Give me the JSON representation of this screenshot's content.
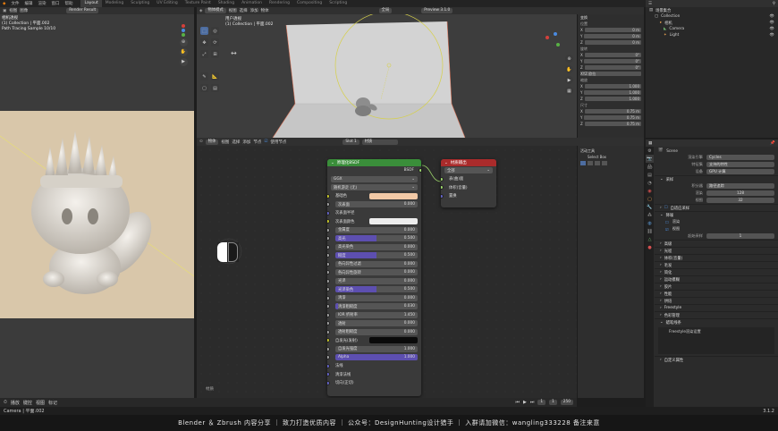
{
  "topbar": {
    "menus": [
      "文件",
      "编辑",
      "渲染",
      "窗口",
      "帮助"
    ],
    "tabs": [
      "Layout",
      "Modeling",
      "Sculpting",
      "UV Editing",
      "Texture Paint",
      "Shading",
      "Animation",
      "Rendering",
      "Compositing",
      "Scripting"
    ],
    "active_tab": "Layout",
    "scene": "Scene",
    "view_layer": "View Layer"
  },
  "image_editor": {
    "header_items": [
      "视图",
      "图像"
    ],
    "render_result": "Render Result",
    "info_lines": [
      "相机透视",
      "(1) Collection | 平面.002",
      "Path Tracing Sample 10/10"
    ]
  },
  "viewport": {
    "header_items": [
      "物体模式",
      "视图",
      "选择",
      "添加",
      "物体"
    ],
    "transform": "全局",
    "info_lines": [
      "用户透视",
      "(1) Collection | 平面.002"
    ],
    "view_mode": "Preview 3.1.0"
  },
  "n_panel": {
    "title": "变换",
    "loc_label": "位置",
    "loc": [
      [
        "X",
        "0 m"
      ],
      [
        "Y",
        "0 m"
      ],
      [
        "Z",
        "0 m"
      ]
    ],
    "rot_label": "旋转",
    "rot": [
      [
        "X",
        "0°"
      ],
      [
        "Y",
        "0°"
      ],
      [
        "Z",
        "0°"
      ]
    ],
    "mode": "XYZ 欧拉",
    "scale_label": "缩放",
    "scale": [
      [
        "X",
        "1.000"
      ],
      [
        "Y",
        "1.000"
      ],
      [
        "Z",
        "1.000"
      ]
    ],
    "dim_label": "尺寸",
    "dims": [
      [
        "X",
        "0.75 m"
      ],
      [
        "Y",
        "0.75 m"
      ],
      [
        "Z",
        "0.75 m"
      ]
    ]
  },
  "node_editor": {
    "header_items": [
      "物体",
      "视图",
      "选择",
      "添加",
      "节点"
    ],
    "use_nodes": "使用节点",
    "slot": "Slot 1",
    "material": "材质",
    "label": "材质"
  },
  "bsdf": {
    "title": "原理化BSDF",
    "out_label": "BSDF",
    "distribution": "GGX",
    "subsurface_method": "随机游走 (无)",
    "base_color_label": "基础色",
    "base_color": "#f2c9a6",
    "rows": [
      {
        "label": "次表面",
        "value": "0.000",
        "fill": 0
      },
      {
        "label": "次表面半径",
        "value": "",
        "fill": 0,
        "type": "vector"
      },
      {
        "label": "次表面颜色",
        "value": "",
        "fill": 0,
        "type": "color",
        "color": "#ececec"
      },
      {
        "label": "金属度",
        "value": "0.000",
        "fill": 0
      },
      {
        "label": "高光",
        "value": "0.500",
        "fill": 0.5
      },
      {
        "label": "高光染色",
        "value": "0.000",
        "fill": 0
      },
      {
        "label": "糙度",
        "value": "0.500",
        "fill": 0.5
      },
      {
        "label": "各向异性过滤",
        "value": "0.000",
        "fill": 0
      },
      {
        "label": "各向异性旋转",
        "value": "0.000",
        "fill": 0
      },
      {
        "label": "光泽",
        "value": "0.000",
        "fill": 0
      },
      {
        "label": "光泽染色",
        "value": "0.500",
        "fill": 0.5
      },
      {
        "label": "清漆",
        "value": "0.000",
        "fill": 0
      },
      {
        "label": "清漆粗糙度",
        "value": "0.030",
        "fill": 0.03
      },
      {
        "label": "IOR 折射率",
        "value": "1.450",
        "fill": 0
      },
      {
        "label": "透射",
        "value": "0.000",
        "fill": 0
      },
      {
        "label": "透射粗糙度",
        "value": "0.000",
        "fill": 0
      }
    ],
    "emission_label": "自发光(发射)",
    "emission_color": "#0a0a0a",
    "emission_strength_label": "自发光强度",
    "emission_strength": "1.000",
    "alpha_label": "Alpha",
    "alpha": "1.000",
    "normal_label": "法线",
    "clearcoat_normal_label": "清漆法线",
    "tangent_label": "切向(正切)"
  },
  "material_output": {
    "title": "材质输出",
    "target": "全部",
    "sockets": [
      "表(曲)面",
      "体积(音量)",
      "置换"
    ]
  },
  "node_sidebar": {
    "title": "活动工具",
    "tool": "Select Box"
  },
  "outliner": {
    "title": "场景集合",
    "items": [
      {
        "label": "Collection",
        "depth": 1
      },
      {
        "label": "相机",
        "depth": 2
      },
      {
        "label": "Camera",
        "depth": 2
      },
      {
        "label": "Light",
        "depth": 2
      }
    ]
  },
  "properties": {
    "scene_label": "Scene",
    "render_engine_label": "渲染引擎",
    "render_engine": "Cycles",
    "feature_set_label": "特征集",
    "feature_set": "支持的特性",
    "device_label": "设备",
    "device": "GPU 计算",
    "sampling_label": "采样",
    "integrator_label": "积分器",
    "integrator": "路径追踪",
    "render_label": "渲染",
    "render_samples": "128",
    "viewport_label": "视图",
    "viewport_samples": "32",
    "adaptive_label": "自适应采样",
    "denoise_label": "降噪",
    "denoise_render": "渲染",
    "denoise_viewport": "视图",
    "start_label": "起始采样",
    "start_value": "1",
    "sections": [
      "高级",
      "光程",
      "体积(音量)",
      "毛发",
      "简化",
      "运动模糊",
      "胶片",
      "性能",
      "烘焙",
      "Freestyle",
      "色彩管理"
    ],
    "light_paths_label": "光程",
    "grease_label": "蜡笔线条",
    "grease_sub": "Freestyle渲染设置",
    "custom_props_label": "自定义属性"
  },
  "bottom": {
    "items": [
      "播放",
      "键控",
      "视图",
      "标记"
    ],
    "frame": "1",
    "start": "1",
    "end": "250"
  },
  "status": {
    "left": "Camera | 平面.002",
    "right": "3.1.2"
  },
  "caption": "Blender ＆ Zbrush 内容分享 ｜ 致力打造优质内容 ｜ 公众号：DesignHunting设计猎手 ｜ 入群请加微信：wangling333228 备注来意",
  "colors": {
    "bsdf_header": "#3a8e3a",
    "output_header": "#aa2b2b",
    "accent": "#5d4fb0",
    "socket_yellow": "#c7c729",
    "socket_purple": "#6363c7",
    "socket_gray": "#a1a1a1"
  }
}
